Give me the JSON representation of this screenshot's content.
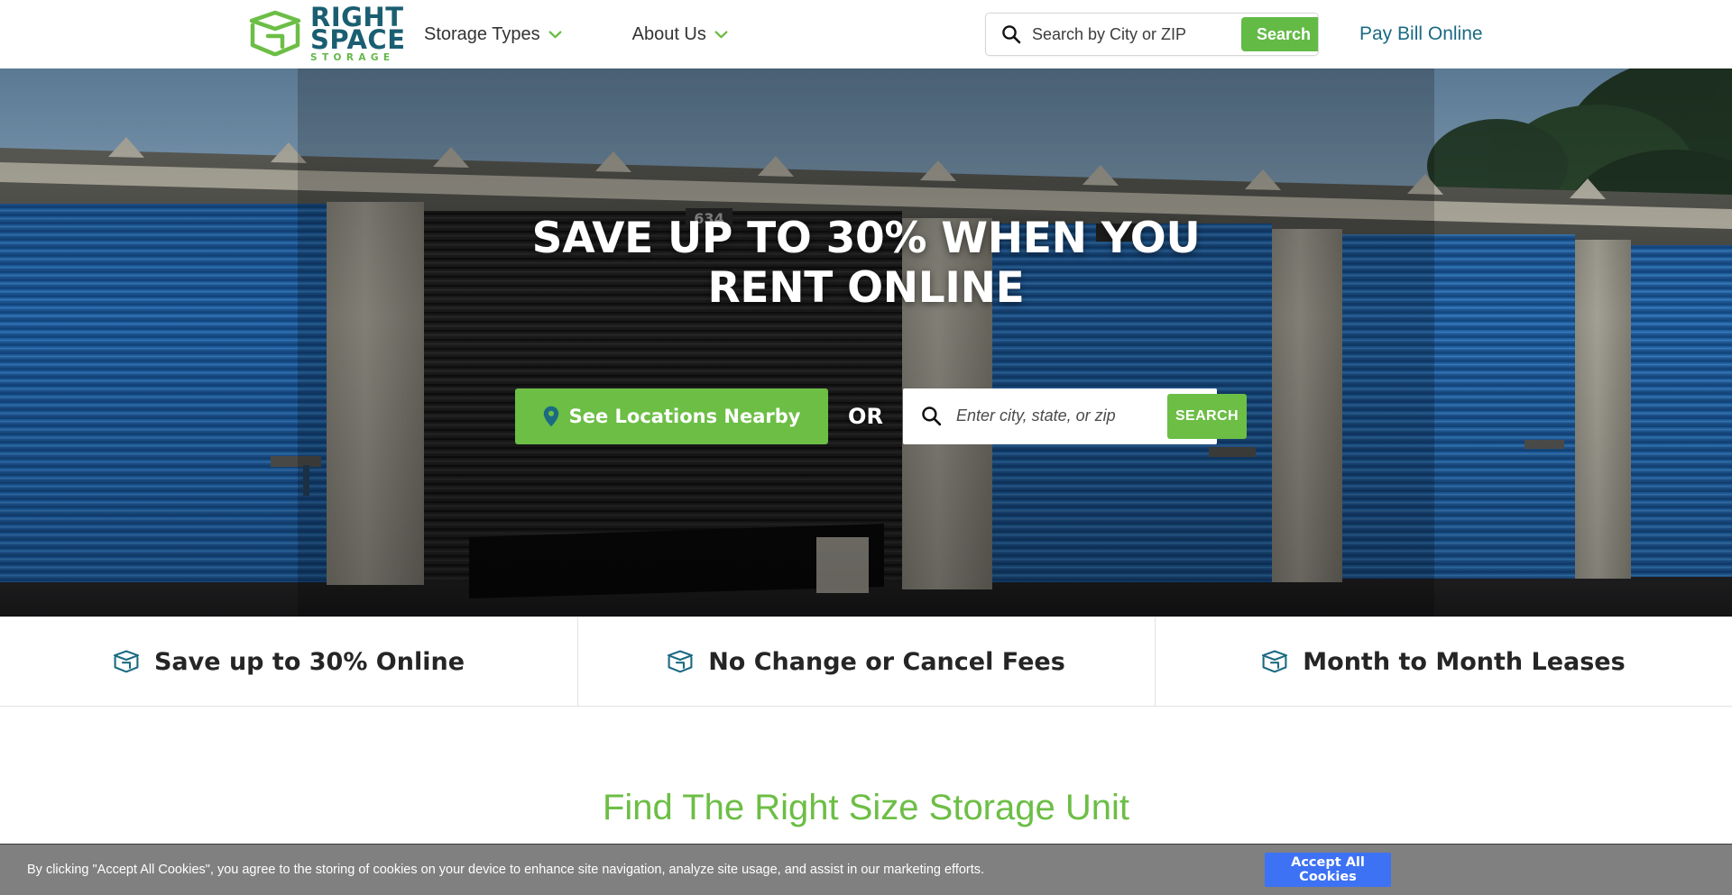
{
  "brand": {
    "logo_line1": "RIGHT",
    "logo_line2": "SPACE",
    "logo_line3": "STORAGE",
    "color_green": "#6cbe45",
    "color_teal": "#1b5e72"
  },
  "header": {
    "nav": [
      {
        "label": "Storage Types",
        "icon": "chevron-down-icon"
      },
      {
        "label": "About Us",
        "icon": "chevron-down-icon"
      }
    ],
    "search": {
      "placeholder": "Search by City or ZIP",
      "value": "",
      "button_label": "Search",
      "icon": "search-icon"
    },
    "pay_bill_label": "Pay Bill Online"
  },
  "hero": {
    "title": "SAVE UP TO 30% WHEN YOU RENT ONLINE",
    "locations_button": {
      "label": "See Locations Nearby",
      "icon": "map-pin-icon"
    },
    "separator": "OR",
    "search": {
      "placeholder": "Enter city, state, or zip",
      "value": "",
      "button_label": "SEARCH",
      "icon": "search-icon"
    }
  },
  "features": [
    {
      "label": "Save up to 30% Online",
      "icon": "box-icon"
    },
    {
      "label": "No Change or Cancel Fees",
      "icon": "box-icon"
    },
    {
      "label": "Month to Month Leases",
      "icon": "box-icon"
    }
  ],
  "section": {
    "title": "Find The Right Size Storage Unit"
  },
  "cookie_banner": {
    "text": "By clicking \"Accept All Cookies\", you agree to the storing of cookies on your device to enhance site navigation, analyze site usage, and assist in our marketing efforts.",
    "accept_label": "Accept All Cookies"
  }
}
